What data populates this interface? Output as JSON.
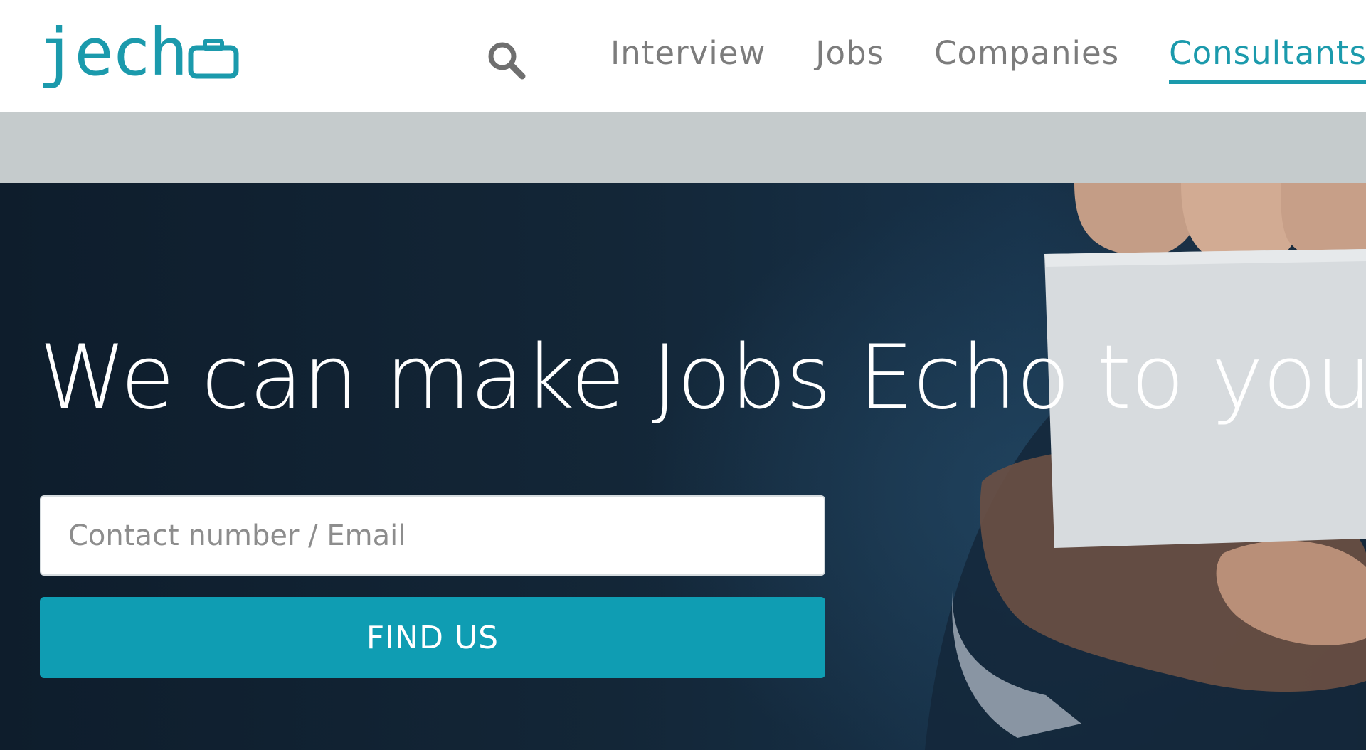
{
  "brand": {
    "logo_text": "jech",
    "logo_icon": "briefcase-o-icon",
    "color": "#1b9aac"
  },
  "header": {
    "search_icon": "search-icon",
    "nav": [
      {
        "label": "Interview",
        "active": false
      },
      {
        "label": "Jobs",
        "active": false
      },
      {
        "label": "Companies",
        "active": false
      },
      {
        "label": "Consultants",
        "active": true
      }
    ]
  },
  "hero": {
    "title": "We can make Jobs Echo to you.",
    "contact_placeholder": "Contact number / Email",
    "contact_value": "",
    "find_button_label": "FIND US",
    "button_color": "#0f9db3"
  }
}
